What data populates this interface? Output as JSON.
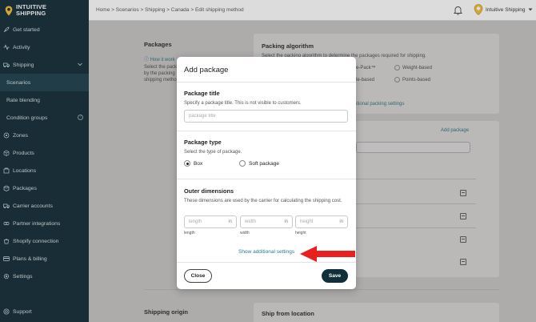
{
  "brand": {
    "name_line1": "INTUITIVE",
    "name_line2": "SHIPPING"
  },
  "sidebar": {
    "items": [
      {
        "label": "Get started",
        "icon": "rocket-icon"
      },
      {
        "label": "Activity",
        "icon": "activity-icon"
      },
      {
        "label": "Shipping",
        "icon": "truck-icon"
      },
      {
        "label": "Scenarios",
        "sub": true,
        "active": true
      },
      {
        "label": "Rate blending",
        "sub": true
      },
      {
        "label": "Condition groups",
        "sub": true
      },
      {
        "label": "Zones",
        "icon": "zones-icon"
      },
      {
        "label": "Products",
        "icon": "products-icon"
      },
      {
        "label": "Locations",
        "icon": "locations-icon"
      },
      {
        "label": "Packages",
        "icon": "packages-icon"
      },
      {
        "label": "Carrier accounts",
        "icon": "carrier-icon"
      },
      {
        "label": "Partner integrations",
        "icon": "partner-icon"
      },
      {
        "label": "Shopify connection",
        "icon": "shopify-icon"
      },
      {
        "label": "Plans & billing",
        "icon": "billing-icon"
      },
      {
        "label": "Settings",
        "icon": "settings-icon"
      }
    ],
    "support": "Support"
  },
  "topbar": {
    "breadcrumb": "Home > Scenarios > Shipping > Canada > Edit shipping method",
    "store_name": "Intuitive Shipping"
  },
  "background": {
    "packages_title": "Packages",
    "how_it_works": "How it work",
    "packages_desc1": "Select the packa",
    "packages_desc2": "by the packing",
    "packages_desc3": "shipping metho",
    "packing_algorithm": "Packing algorithm",
    "packing_desc": "Select the packing algorithm to determine the packages required for shipping.",
    "opt_epack": "e-Pack™",
    "opt_weight": "Weight-based",
    "opt_size": "le-based",
    "opt_points": "Points-based",
    "additional_packing": "itional packing settings",
    "add_package": "Add package",
    "shipping_origin": "Shipping origin",
    "ship_from": "Ship from location"
  },
  "modal": {
    "title": "Add package",
    "package_title": {
      "heading": "Package title",
      "desc": "Specify a package title. This is not visible to customers.",
      "placeholder": "package title"
    },
    "package_type": {
      "heading": "Package type",
      "desc": "Select the type of package.",
      "options": [
        "Box",
        "Soft package"
      ],
      "selected": "Box"
    },
    "outer_dimensions": {
      "heading": "Outer dimensions",
      "desc": "These dimensions are used by the carrier for calculating the shipping cost.",
      "fields": [
        {
          "placeholder": "length",
          "unit": "in",
          "label": "length"
        },
        {
          "placeholder": "width",
          "unit": "in",
          "label": "width"
        },
        {
          "placeholder": "height",
          "unit": "in",
          "label": "height"
        }
      ]
    },
    "show_additional": "Show additional settings",
    "close_label": "Close",
    "save_label": "Save"
  },
  "colors": {
    "sidebar_bg": "#102a34",
    "accent": "#2d7b86",
    "save_bg": "#112f3a",
    "arrow": "#e8201f"
  }
}
